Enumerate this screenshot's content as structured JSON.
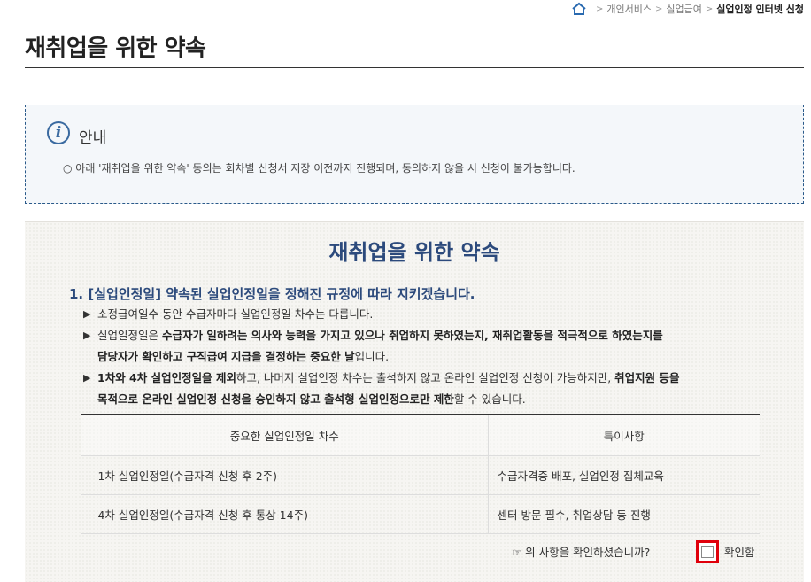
{
  "breadcrumb": {
    "home_icon": "home-icon",
    "items": [
      "개인서비스",
      "실업급여"
    ],
    "current": "실업인정 인터넷 신청"
  },
  "page": {
    "title": "재취업을 위한 약속"
  },
  "notice": {
    "icon": "info-icon",
    "icon_glyph": "i",
    "title": "안내",
    "text": "○ 아래 '재취업을 위한 약속' 동의는 회차별 신청서 저장 이전까지 진행되며, 동의하지 않을 시 신청이 불가능합니다."
  },
  "content": {
    "title": "재취업을 위한 약속",
    "section1": {
      "heading": "1. [실업인정일] 약속된 실업인정일을 정해진 규정에 따라 지키겠습니다.",
      "bullet_mark": "▶",
      "bullets": [
        {
          "line1": "소정급여일수 동안 수급자마다 실업인정일 차수는 다릅니다."
        },
        {
          "line1_a": "실업일정일은 ",
          "line1_b": "수급자가 일하려는 의사와 능력을 가지고 있으나 취업하지 못하였는지, 재취업활동을 적극적으로 하였는지를",
          "line2_a": "담당자가 확인하고 구직급여 지급을 결정하는 중요한 날",
          "line2_b": "입니다."
        },
        {
          "line1_a": "1차와 4차 실업인정일을 제외",
          "line1_b": "하고, 나머지 실업인정 차수는 출석하지 않고 온라인 실업인정 신청이 가능하지만, ",
          "line1_c": "취업지원 등을",
          "line2_a": "목적으로 온라인 실업인정 신청을 승인하지 않고 출석형 실업인정으로만 제한",
          "line2_b": "할 수 있습니다."
        }
      ]
    },
    "table": {
      "headers": [
        "중요한 실업인정일 차수",
        "특이사항"
      ],
      "rows": [
        [
          "- 1차 실업인정일(수급자격 신청 후 2주)",
          "수급자격증 배포, 실업인정 집체교육"
        ],
        [
          "- 4차 실업인정일(수급자격 신청 후 통상 14주)",
          "센터 방문 필수, 취업상담 등 진행"
        ]
      ]
    },
    "confirm": {
      "question": "☞ 위 사항을 확인하셨습니까?",
      "checkbox_checked": false,
      "label": "확인함",
      "highlight_color": "#e0000b"
    }
  }
}
